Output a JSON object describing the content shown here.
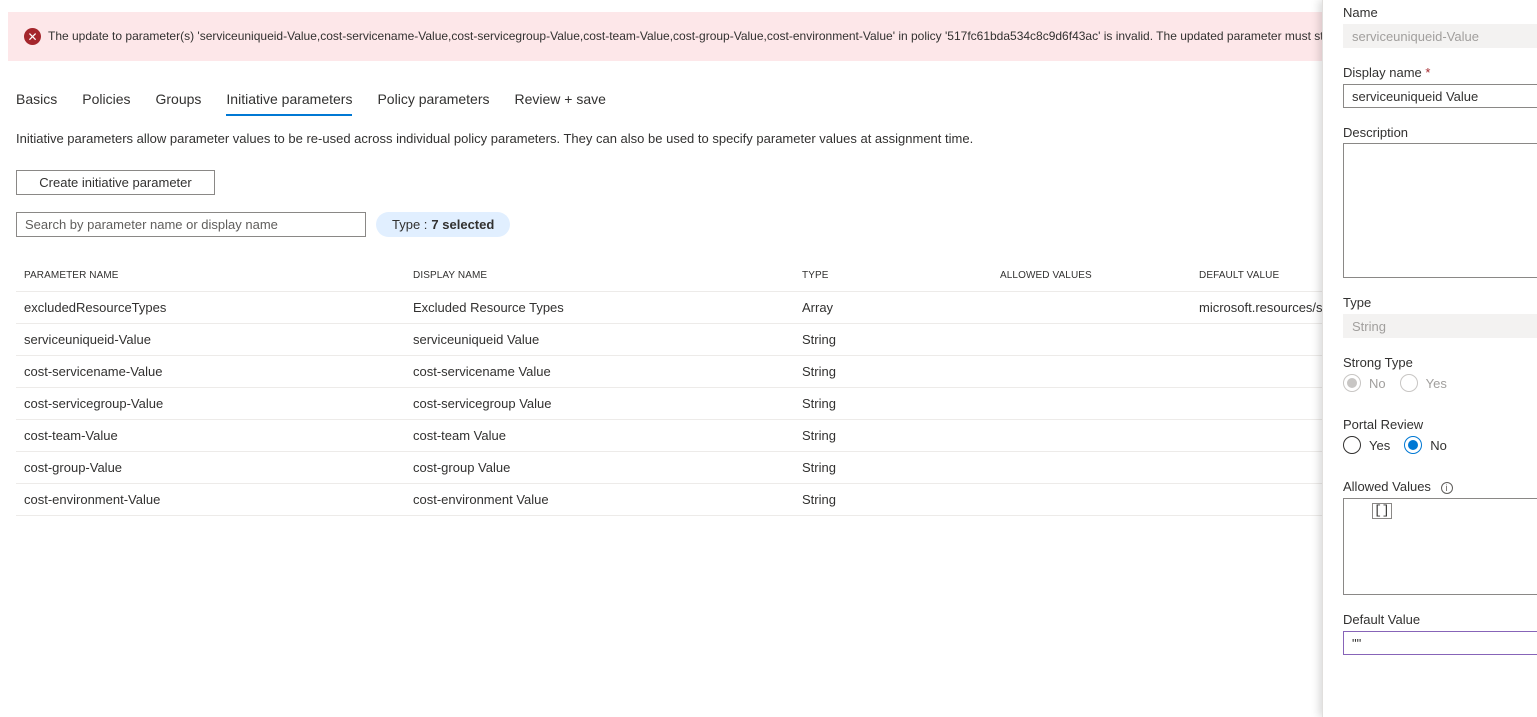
{
  "banner": {
    "message": "The update to parameter(s) 'serviceuniqueid-Value,cost-servicename-Value,cost-servicegroup-Value,cost-team-Value,cost-group-Value,cost-environment-Value' in policy '517fc61bda534c8c9d6f43ac' is invalid. The updated parameter must stil",
    "icon": "error-icon"
  },
  "tabs": [
    {
      "label": "Basics",
      "active": false
    },
    {
      "label": "Policies",
      "active": false
    },
    {
      "label": "Groups",
      "active": false
    },
    {
      "label": "Initiative parameters",
      "active": true
    },
    {
      "label": "Policy parameters",
      "active": false
    },
    {
      "label": "Review + save",
      "active": false
    }
  ],
  "description": "Initiative parameters allow parameter values to be re-used across individual policy parameters. They can also be used to specify parameter values at assignment time.",
  "create_button": "Create initiative parameter",
  "search": {
    "placeholder": "Search by parameter name or display name",
    "value": ""
  },
  "type_filter": {
    "label": "Type :",
    "value": "7 selected"
  },
  "table": {
    "headers": [
      "PARAMETER NAME",
      "DISPLAY NAME",
      "TYPE",
      "ALLOWED VALUES",
      "DEFAULT VALUE"
    ],
    "rows": [
      [
        "excludedResourceTypes",
        "Excluded Resource Types",
        "Array",
        "",
        "microsoft.resources/s"
      ],
      [
        "serviceuniqueid-Value",
        "serviceuniqueid Value",
        "String",
        "",
        ""
      ],
      [
        "cost-servicename-Value",
        "cost-servicename Value",
        "String",
        "",
        ""
      ],
      [
        "cost-servicegroup-Value",
        "cost-servicegroup Value",
        "String",
        "",
        ""
      ],
      [
        "cost-team-Value",
        "cost-team Value",
        "String",
        "",
        ""
      ],
      [
        "cost-group-Value",
        "cost-group Value",
        "String",
        "",
        ""
      ],
      [
        "cost-environment-Value",
        "cost-environment Value",
        "String",
        "",
        ""
      ]
    ]
  },
  "panel": {
    "name_label": "Name",
    "name_value": "serviceuniqueid-Value",
    "display_name_label": "Display name",
    "display_name_required": "*",
    "display_name_value": "serviceuniqueid Value",
    "description_label": "Description",
    "type_label": "Type",
    "type_value": "String",
    "strong_type_label": "Strong Type",
    "strong_type_no": "No",
    "strong_type_yes": "Yes",
    "portal_review_label": "Portal Review",
    "portal_review_yes": "Yes",
    "portal_review_no": "No",
    "allowed_values_label": "Allowed Values",
    "allowed_values_value": "[]",
    "default_value_label": "Default Value",
    "default_value_value": "\"\""
  },
  "colors": {
    "accent": "#0078d4",
    "error": "#a4262c",
    "banner_bg": "#fde7e9",
    "pill_bg": "#e1efff"
  }
}
